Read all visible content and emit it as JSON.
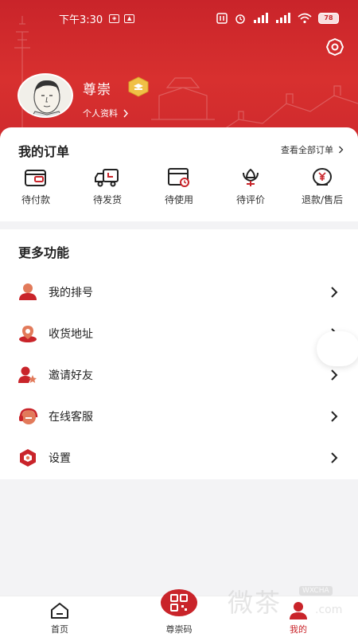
{
  "status_bar": {
    "time": "下午3:30",
    "battery": "78"
  },
  "profile": {
    "username": "尊崇",
    "profile_link_label": "个人资料"
  },
  "orders": {
    "title": "我的订单",
    "view_all_label": "查看全部订单",
    "items": [
      {
        "label": "待付款",
        "icon": "wallet-icon"
      },
      {
        "label": "待发货",
        "icon": "truck-icon"
      },
      {
        "label": "待使用",
        "icon": "ticket-clock-icon"
      },
      {
        "label": "待评价",
        "icon": "flower-icon"
      },
      {
        "label": "退款/售后",
        "icon": "refund-yuan-icon"
      }
    ]
  },
  "more": {
    "title": "更多功能",
    "items": [
      {
        "label": "我的排号",
        "icon": "person-icon"
      },
      {
        "label": "收货地址",
        "icon": "location-icon"
      },
      {
        "label": "邀请好友",
        "icon": "invite-star-icon"
      },
      {
        "label": "在线客服",
        "icon": "headset-icon"
      },
      {
        "label": "设置",
        "icon": "hexagon-settings-icon"
      }
    ]
  },
  "bottom_nav": {
    "tabs": [
      {
        "label": "首页",
        "icon": "home-icon",
        "active": false
      },
      {
        "label": "尊崇码",
        "icon": "qrcode-icon",
        "active": false
      },
      {
        "label": "我的",
        "icon": "profile-icon",
        "active": true
      }
    ]
  },
  "watermark": {
    "main": "微茶",
    "tag": "WXCHA",
    "domain": ".com"
  },
  "colors": {
    "brand_red": "#c9242a",
    "text": "#222222",
    "background": "#f3f3f5"
  }
}
